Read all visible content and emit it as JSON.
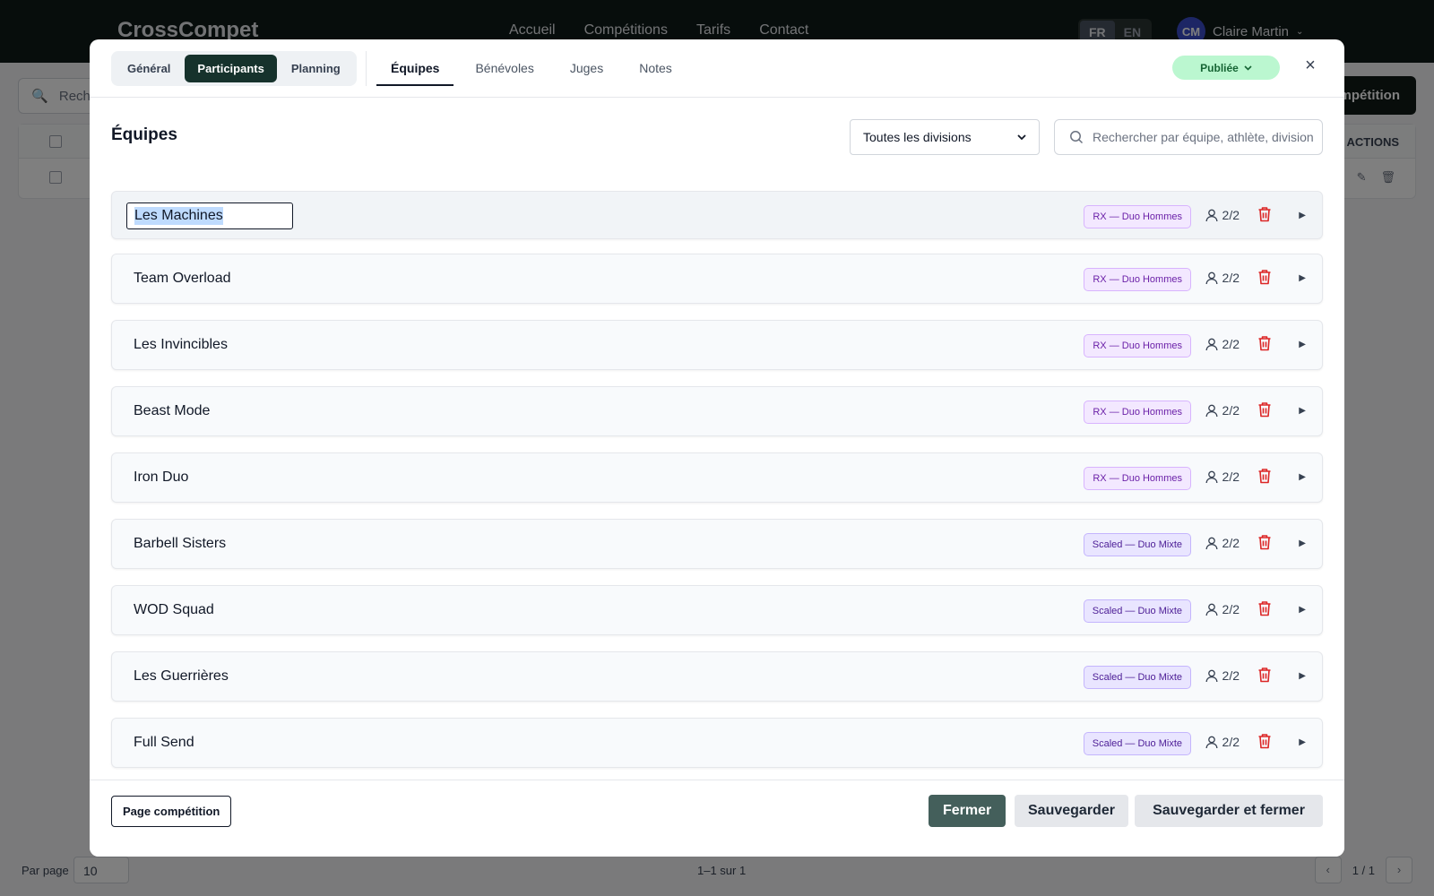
{
  "app": {
    "brand": "CrossCompet",
    "nav": [
      "Accueil",
      "Compétitions",
      "Tarifs",
      "Contact"
    ],
    "languages": [
      "FR",
      "EN"
    ],
    "active_language": "FR",
    "user": {
      "initials": "CM",
      "name": "Claire Martin"
    },
    "search_placeholder": "Recher",
    "create_button": "mpétition",
    "table_header_actions": "ACTIONS",
    "footer": {
      "per_page_label": "Par page",
      "per_page_value": "10",
      "range": "1–1 sur 1",
      "page": "1 / 1"
    }
  },
  "modal": {
    "main_tabs": [
      {
        "label": "Général",
        "active": false
      },
      {
        "label": "Participants",
        "active": true
      },
      {
        "label": "Planning",
        "active": false
      }
    ],
    "sub_tabs": [
      {
        "label": "Équipes",
        "active": true
      },
      {
        "label": "Bénévoles",
        "active": false
      },
      {
        "label": "Juges",
        "active": false
      },
      {
        "label": "Notes",
        "active": false
      }
    ],
    "status": {
      "label": "Publiée",
      "color": "#bbf7d0"
    },
    "close_icon": "×",
    "section_title": "Équipes",
    "division_filter": {
      "selected": "Toutes les divisions"
    },
    "search": {
      "placeholder": "Rechercher par équipe, athlète, division"
    },
    "teams": [
      {
        "name": "Les Machines",
        "editing": true,
        "division": "RX — Duo Hommes",
        "division_type": "rx",
        "members": "2/2"
      },
      {
        "name": "Team Overload",
        "editing": false,
        "division": "RX — Duo Hommes",
        "division_type": "rx",
        "members": "2/2"
      },
      {
        "name": "Les Invincibles",
        "editing": false,
        "division": "RX — Duo Hommes",
        "division_type": "rx",
        "members": "2/2"
      },
      {
        "name": "Beast Mode",
        "editing": false,
        "division": "RX — Duo Hommes",
        "division_type": "rx",
        "members": "2/2"
      },
      {
        "name": "Iron Duo",
        "editing": false,
        "division": "RX — Duo Hommes",
        "division_type": "rx",
        "members": "2/2"
      },
      {
        "name": "Barbell Sisters",
        "editing": false,
        "division": "Scaled — Duo Mixte",
        "division_type": "scaled",
        "members": "2/2"
      },
      {
        "name": "WOD Squad",
        "editing": false,
        "division": "Scaled — Duo Mixte",
        "division_type": "scaled",
        "members": "2/2"
      },
      {
        "name": "Les Guerrières",
        "editing": false,
        "division": "Scaled — Duo Mixte",
        "division_type": "scaled",
        "members": "2/2"
      },
      {
        "name": "Full Send",
        "editing": false,
        "division": "Scaled — Duo Mixte",
        "division_type": "scaled",
        "members": "2/2"
      }
    ],
    "footer": {
      "page_button": "Page compétition",
      "close_button": "Fermer",
      "save_button": "Sauvegarder",
      "save_close_button": "Sauvegarder et fermer"
    },
    "colors": {
      "accent": "#16322c",
      "delete": "#dc2626",
      "close_button": "#445f5b"
    }
  }
}
